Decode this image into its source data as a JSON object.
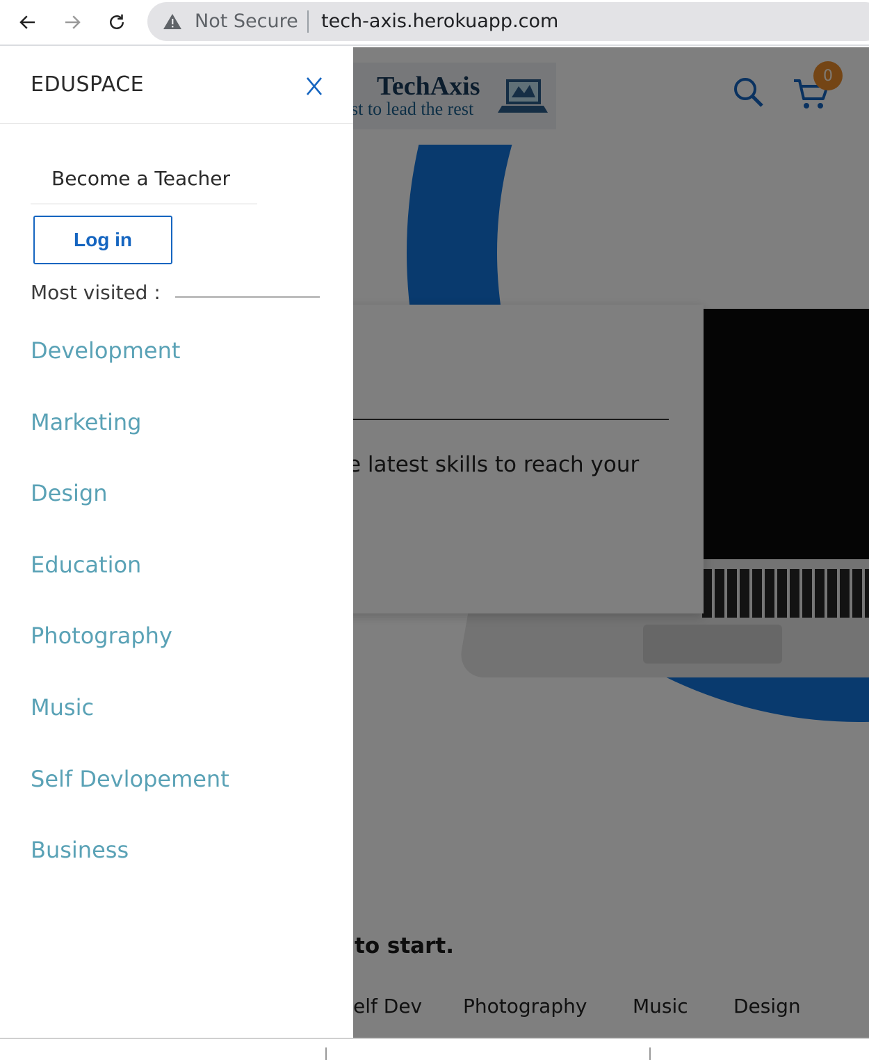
{
  "browser": {
    "security_label": "Not Secure",
    "url": "tech-axis.herokuapp.com"
  },
  "site": {
    "logo_title": "TechAxis",
    "logo_tagline": "st to lead the rest",
    "cart_count": "0",
    "hero_subtitle": "e latest skills to reach your",
    "section_headline": "to start.",
    "category_tabs": [
      "elf Dev",
      "Photography",
      "Music",
      "Design"
    ]
  },
  "drawer": {
    "brand": "EDUSPACE",
    "become_teacher": "Become a Teacher",
    "login_label": "Log in",
    "most_visited_label": "Most visited :",
    "categories": [
      "Development",
      "Marketing",
      "Design",
      "Education",
      "Photography",
      "Music",
      "Self Devlopement",
      "Business"
    ]
  },
  "colors": {
    "accent_blue": "#1565c0",
    "category_teal": "#5aa2b6",
    "cart_badge": "#e98a2a"
  },
  "icons": [
    "back-arrow-icon",
    "forward-arrow-icon",
    "reload-icon",
    "warning-icon",
    "search-icon",
    "cart-icon",
    "close-icon"
  ]
}
